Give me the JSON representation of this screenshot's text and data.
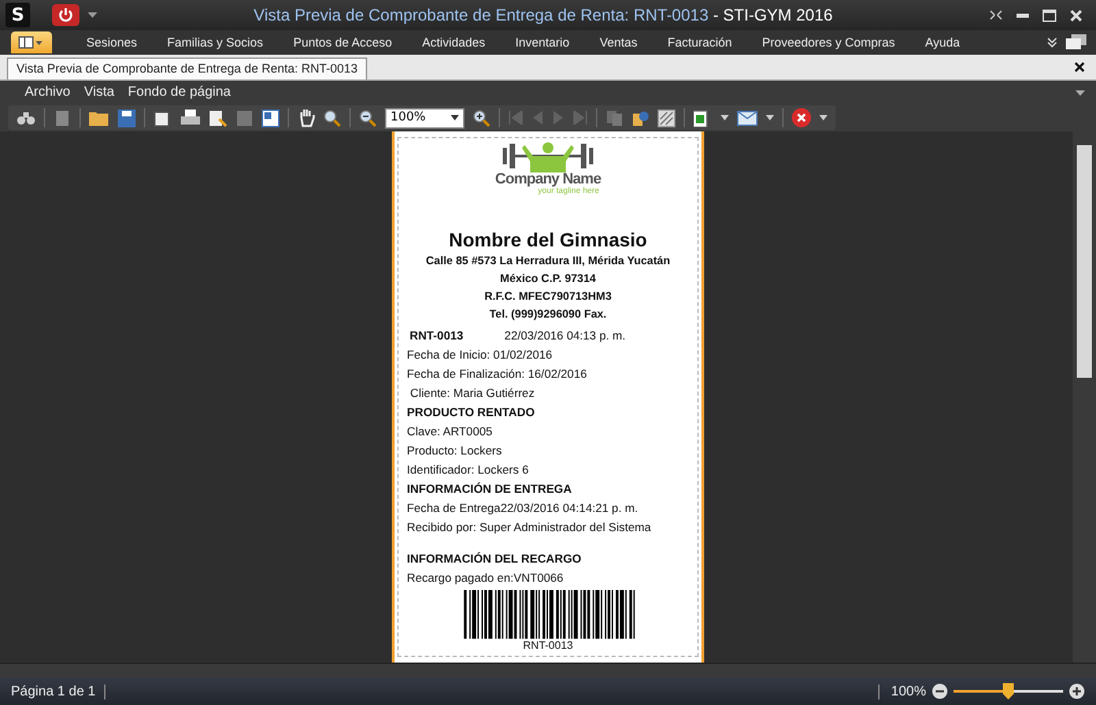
{
  "window": {
    "logo": "S",
    "title_doc": "Vista Previa de Comprobante de Entrega de Renta: RNT-0013",
    "separator": "-",
    "title_app": "STI-GYM 2016"
  },
  "ribbon_tabs": [
    {
      "label": "Sesiones",
      "selected": false
    },
    {
      "label": "Familias y Socios",
      "selected": false
    },
    {
      "label": "Puntos de Acceso",
      "selected": false
    },
    {
      "label": "Actividades",
      "selected": false
    },
    {
      "label": "Inventario",
      "selected": false
    },
    {
      "label": "Ventas",
      "selected": false
    },
    {
      "label": "Facturación",
      "selected": false
    },
    {
      "label": "Proveedores y Compras",
      "selected": false
    },
    {
      "label": "Ayuda",
      "selected": false
    }
  ],
  "document_tab": {
    "label": "Vista Previa de Comprobante de Entrega de Renta: RNT-0013",
    "selected": true
  },
  "menu": [
    "Archivo",
    "Vista",
    "Fondo de página"
  ],
  "toolbar": {
    "zoom": "100%"
  },
  "receipt": {
    "logo": {
      "company": "Company Name",
      "tagline": "your tagline here"
    },
    "gym_name": "Nombre del Gimnasio",
    "address_lines": [
      "Calle 85 #573  La Herradura III, Mérida Yucatán",
      "México C.P. 97314",
      "R.F.C. MFEC790713HM3",
      "Tel. (999)9296090  Fax."
    ],
    "folio": {
      "number": "RNT-0013",
      "datetime": "22/03/2016 04:13 p. m."
    },
    "lines": [
      {
        "kind": "text",
        "text": "Fecha de Inicio: 01/02/2016",
        "gap_before": false
      },
      {
        "kind": "text",
        "text": "Fecha de Finalización: 16/02/2016",
        "gap_before": false
      },
      {
        "kind": "text",
        "text": " Cliente: Maria Gutiérrez",
        "gap_before": false
      },
      {
        "kind": "heading",
        "text": "PRODUCTO RENTADO",
        "gap_before": false
      },
      {
        "kind": "text",
        "text": "Clave: ART0005",
        "gap_before": false
      },
      {
        "kind": "text",
        "text": "Producto: Lockers",
        "gap_before": false
      },
      {
        "kind": "text",
        "text": "Identificador: Lockers 6",
        "gap_before": false
      },
      {
        "kind": "heading",
        "text": "INFORMACIÓN DE ENTREGA",
        "gap_before": false
      },
      {
        "kind": "text",
        "text": "Fecha de Entrega22/03/2016 04:14:21 p. m.",
        "gap_before": false
      },
      {
        "kind": "text",
        "text": "Recibido por: Super Administrador del Sistema",
        "gap_before": false
      },
      {
        "kind": "heading",
        "text": "INFORMACIÓN DEL RECARGO",
        "gap_before": true
      },
      {
        "kind": "text",
        "text": "Recargo pagado en:VNT0066",
        "gap_before": false
      }
    ],
    "barcode_caption": "RNT-0013"
  },
  "status_bar": {
    "page": "Página 1 de 1",
    "zoom": "100%",
    "zoom_slider": {
      "level": 0.5
    }
  }
}
